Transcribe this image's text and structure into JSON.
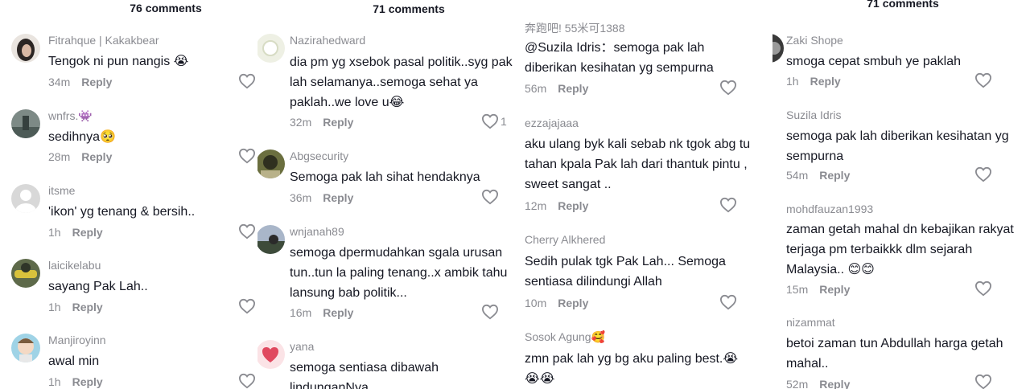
{
  "panels": [
    {
      "count": "76 comments",
      "comments": [
        {
          "user": "Fitrahque | Kakakbear",
          "text": "Tengok ni pun nangis 😭",
          "time": "34m",
          "reply": "Reply"
        },
        {
          "user": "wnfrs.👾",
          "text": "sedihnya🥺",
          "time": "28m",
          "reply": "Reply"
        },
        {
          "user": "itsme",
          "text": "'ikon' yg tenang & bersih..",
          "time": "1h",
          "reply": "Reply"
        },
        {
          "user": "laicikelabu",
          "text": "sayang Pak Lah..",
          "time": "1h",
          "reply": "Reply"
        },
        {
          "user": "Manjiroyinn",
          "text": "awal min",
          "time": "1h",
          "reply": "Reply"
        }
      ]
    },
    {
      "count": "71 comments",
      "comments": [
        {
          "user": "Nazirahedward",
          "text": "dia pm yg xsebok pasal politik..syg pak\nlah selamanya..semoga sehat ya\npaklah..we love u😂",
          "time": "32m",
          "reply": "Reply",
          "likes": "1"
        },
        {
          "user": "Abgsecurity",
          "text": "Semoga pak lah sihat hendaknya",
          "time": "36m",
          "reply": "Reply"
        },
        {
          "user": "wnjanah89",
          "text": "semoga dpermudahkan sgala urusan\ntun..tun la paling tenang..x ambik tahu\nlansung bab politik...",
          "time": "16m",
          "reply": "Reply"
        },
        {
          "user": "yana",
          "text": "semoga sentiasa dibawah lindunganNya",
          "time": "",
          "reply": ""
        }
      ]
    },
    {
      "count": "",
      "comments": [
        {
          "user": "奔跑吧! 55米可1388",
          "text": "@Suzila Idris：semoga pak lah\ndiberikan kesihatan yg sempurna",
          "time": "56m",
          "reply": "Reply"
        },
        {
          "user": "ezzajajaaa",
          "text": "aku ulang byk kali sebab nk tgok abg tu\ntahan kpala Pak lah dari thantuk pintu ,\nsweet sangat ..",
          "time": "12m",
          "reply": "Reply"
        },
        {
          "user": "Cherry Alkhered",
          "text": "Sedih pulak tgk Pak Lah... Semoga\nsentiasa dilindungi Allah",
          "time": "10m",
          "reply": "Reply"
        },
        {
          "user": "Sosok Agung🥰",
          "text": "zmn pak lah yg bg aku paling best.😭\n😭😭",
          "time": "",
          "reply": ""
        }
      ]
    },
    {
      "count": "71 comments",
      "comments": [
        {
          "user": "Zaki Shope",
          "text": "smoga cepat smbuh ye paklah",
          "time": "1h",
          "reply": "Reply"
        },
        {
          "user": "Suzila Idris",
          "text": "semoga pak lah diberikan kesihatan yg\nsempurna",
          "time": "54m",
          "reply": "Reply"
        },
        {
          "user": "mohdfauzan1993",
          "text": "zaman getah mahal dn kebajikan rakyat\nterjaga pm terbaikkk dlm sejarah\nMalaysia.. 😊😊",
          "time": "15m",
          "reply": "Reply"
        },
        {
          "user": "nizammat",
          "text": "betoi zaman tun Abdullah harga getah\nmahal..",
          "time": "52m",
          "reply": "Reply"
        }
      ]
    }
  ],
  "icons": {
    "heart": "heart-outline-icon"
  },
  "colors": {
    "text": "#161823",
    "muted": "#8a8b91",
    "heart": "#8a8b91"
  }
}
